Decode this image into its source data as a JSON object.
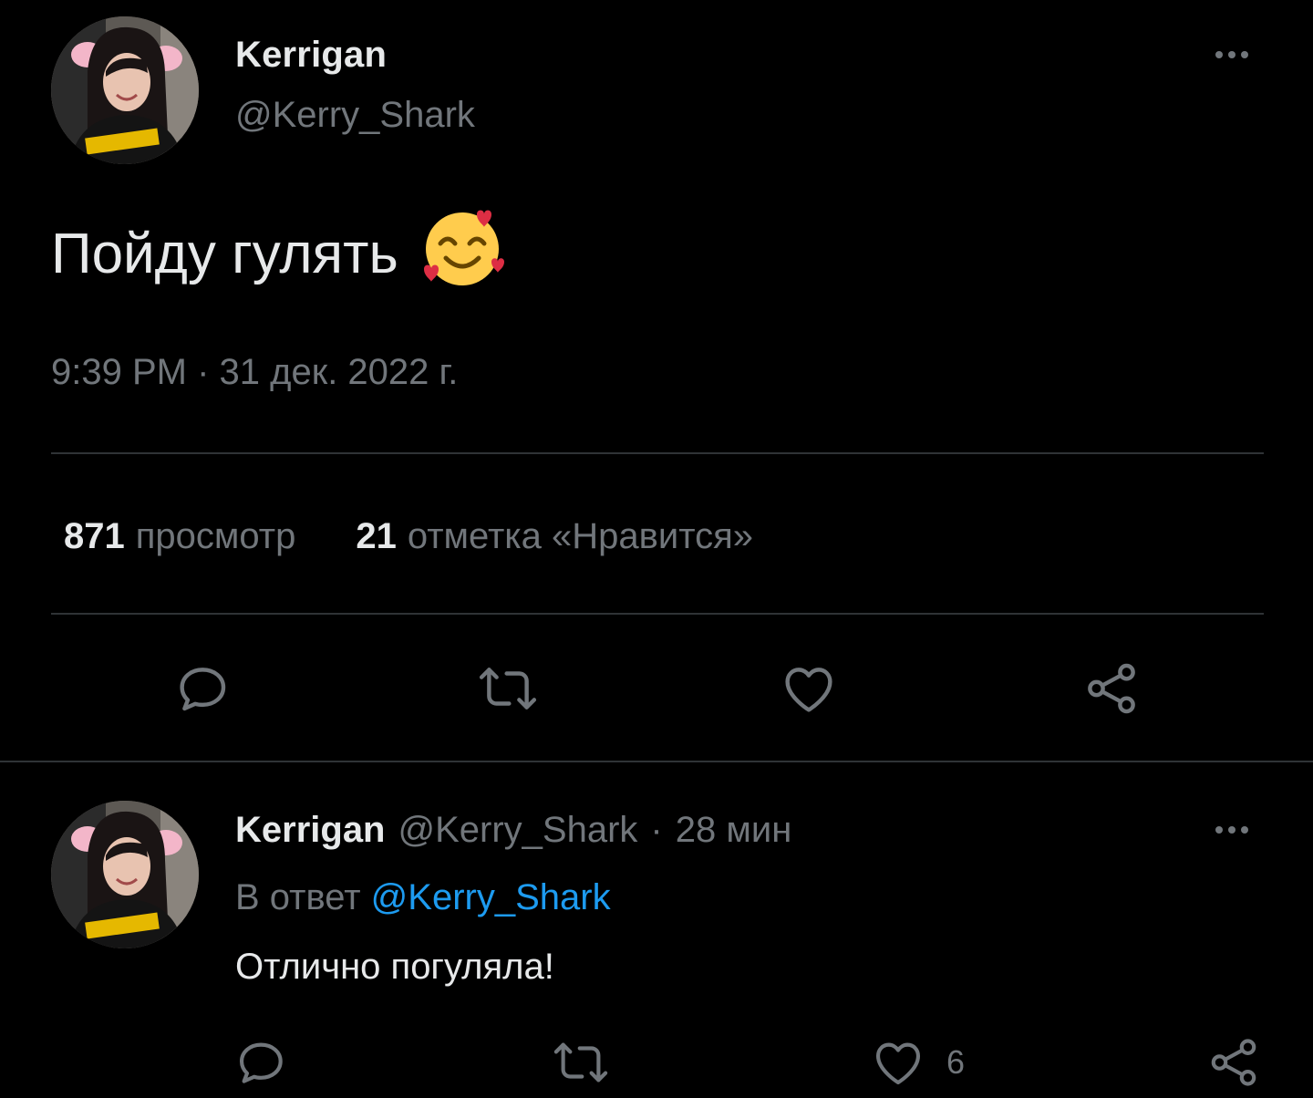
{
  "main_tweet": {
    "author": {
      "name": "Kerrigan",
      "handle": "@Kerry_Shark",
      "avatar": "profile-photo"
    },
    "text": "Пойду гулять",
    "emoji": "smiling-face-with-hearts",
    "timestamp": "9:39 PM · 31 дек. 2022 г.",
    "stats": {
      "views_count": "871",
      "views_label": "просмотр",
      "likes_count": "21",
      "likes_label": "отметка «Нравится»"
    },
    "actions": [
      "reply-icon",
      "retweet-icon",
      "like-icon",
      "share-icon"
    ]
  },
  "reply_tweet": {
    "author": {
      "name": "Kerrigan",
      "handle": "@Kerry_Shark",
      "avatar": "profile-photo"
    },
    "separator": "·",
    "time_ago": "28 мин",
    "replying_prefix": "В ответ",
    "replying_to": "@Kerry_Shark",
    "text": "Отлично погуляла!",
    "likes_count": "6",
    "actions": [
      "reply-icon",
      "retweet-icon",
      "like-icon",
      "share-icon"
    ]
  },
  "colors": {
    "background": "#000000",
    "text_primary": "#e7e9ea",
    "text_secondary": "#71767b",
    "link": "#1d9bf0",
    "divider": "#2f3336"
  }
}
